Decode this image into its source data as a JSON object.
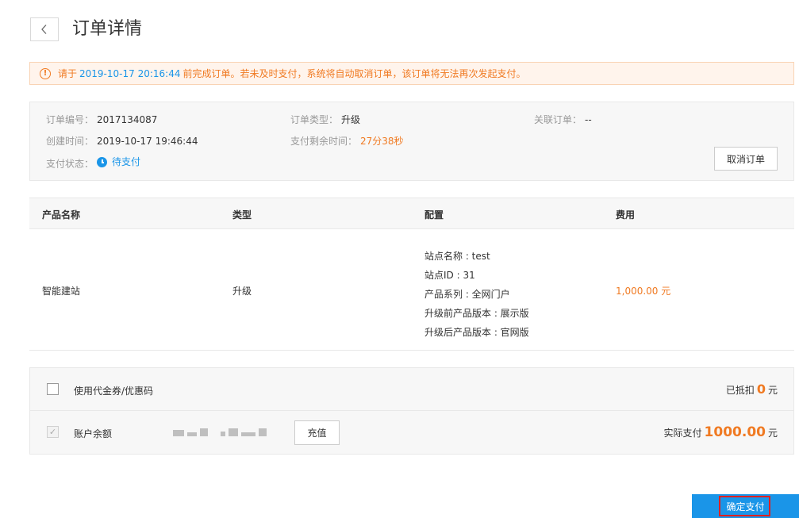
{
  "header": {
    "back_icon": "chevron-left-icon",
    "title": "订单详情"
  },
  "alert": {
    "icon": "exclamation-circle-icon",
    "prefix": "请于",
    "deadline": "2019-10-17 20:16:44",
    "suffix": "前完成订单。若未及时支付，系统将自动取消订单，该订单将无法再次发起支付。"
  },
  "order_info": {
    "order_no_label": "订单编号：",
    "order_no": "2017134087",
    "order_type_label": "订单类型：",
    "order_type": "升级",
    "related_label": "关联订单：",
    "related": "--",
    "created_label": "创建时间：",
    "created": "2019-10-17 19:46:44",
    "remaining_label": "支付剩余时间：",
    "remaining": "27分38秒",
    "status_label": "支付状态：",
    "status": "待支付",
    "cancel_label": "取消订单"
  },
  "products": {
    "headers": [
      "产品名称",
      "类型",
      "配置",
      "费用"
    ],
    "rows": [
      {
        "name": "智能建站",
        "type": "升级",
        "config": [
          "站点名称 : test",
          "站点ID : 31",
          "产品系列 : 全网门户",
          "升级前产品版本 : 展示版",
          "升级后产品版本 : 官网版"
        ],
        "fee": "1,000.00 元"
      }
    ]
  },
  "payment": {
    "coupon_label": "使用代金券/优惠码",
    "coupon_checked": false,
    "deducted_label": "已抵扣",
    "deducted_value": "0",
    "deducted_unit": "元",
    "balance_label": "账户余额",
    "balance_checked": true,
    "recharge_label": "充值",
    "actual_label": "实际支付",
    "actual_value": "1000.00",
    "actual_unit": "元"
  },
  "confirm": {
    "label": "确定支付"
  },
  "colors": {
    "accent_blue": "#1a95e8",
    "accent_orange": "#f07a22",
    "highlight_red": "#e02020"
  }
}
